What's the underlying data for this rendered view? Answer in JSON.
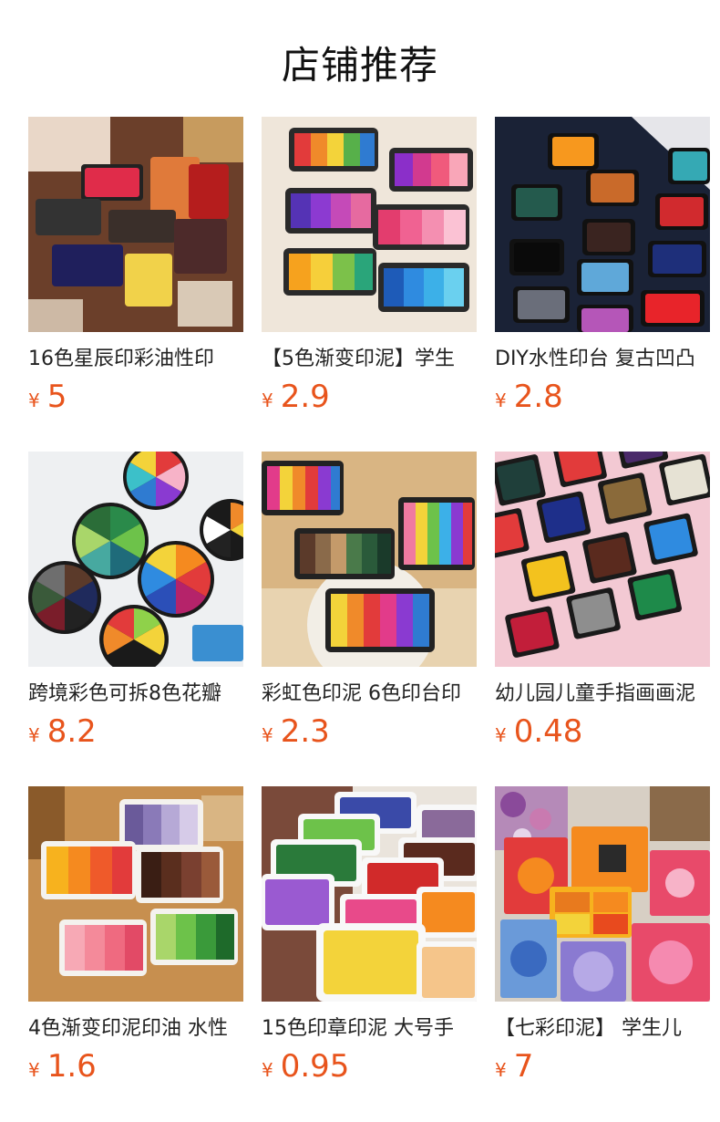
{
  "section": {
    "title": "店铺推荐"
  },
  "theme": {
    "price_color": "#e8541c"
  },
  "products": [
    {
      "name": "16色星辰印彩油性印",
      "currency": "¥",
      "price": "5"
    },
    {
      "name": "【5色渐变印泥】学生",
      "currency": "¥",
      "price": "2.9"
    },
    {
      "name": "DIY水性印台 复古凹凸",
      "currency": "¥",
      "price": "2.8"
    },
    {
      "name": "跨境彩色可拆8色花瓣",
      "currency": "¥",
      "price": "8.2"
    },
    {
      "name": "彩虹色印泥 6色印台印",
      "currency": "¥",
      "price": "2.3"
    },
    {
      "name": "幼儿园儿童手指画画泥",
      "currency": "¥",
      "price": "0.48"
    },
    {
      "name": "4色渐变印泥印油 水性",
      "currency": "¥",
      "price": "1.6"
    },
    {
      "name": "15色印章印泥 大号手",
      "currency": "¥",
      "price": "0.95"
    },
    {
      "name": "【七彩印泥】 学生儿",
      "currency": "¥",
      "price": "7"
    }
  ]
}
